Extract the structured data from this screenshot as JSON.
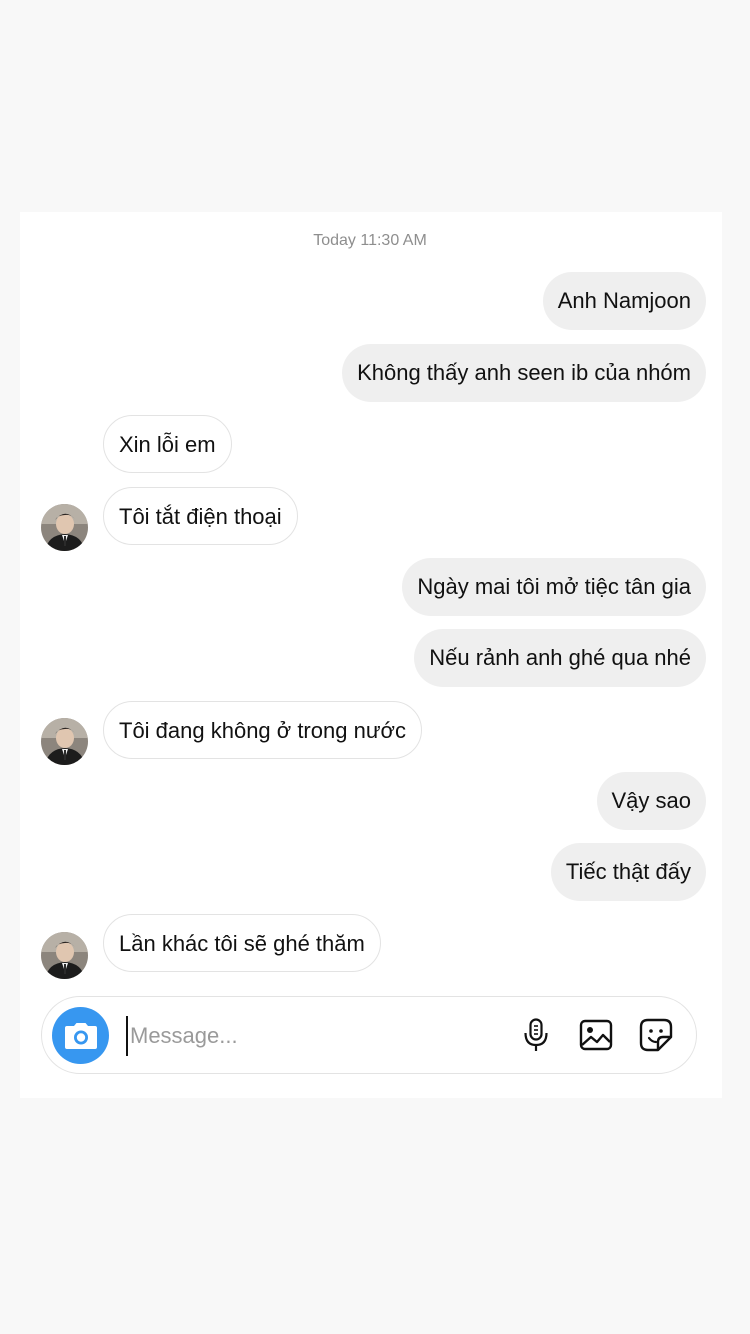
{
  "chat": {
    "timestamp": "Today 11:30 AM",
    "messages": [
      {
        "side": "sent",
        "text": "Anh Namjoon"
      },
      {
        "side": "sent",
        "text": "Không thấy anh seen ib của nhóm"
      },
      {
        "side": "received",
        "text": "Xin lỗi em"
      },
      {
        "side": "received",
        "text": "Tôi tắt điện thoại",
        "avatar": true
      },
      {
        "side": "sent",
        "text": "Ngày mai tôi mở tiệc tân gia"
      },
      {
        "side": "sent",
        "text": "Nếu rảnh anh ghé qua nhé"
      },
      {
        "side": "received",
        "text": "Tôi đang không ở trong nước",
        "avatar": true
      },
      {
        "side": "sent",
        "text": "Vậy sao"
      },
      {
        "side": "sent",
        "text": "Tiếc thật đấy"
      },
      {
        "side": "received",
        "text": "Lần khác tôi sẽ ghé thăm",
        "avatar": true
      }
    ]
  },
  "composer": {
    "placeholder": "Message...",
    "value": "",
    "camera_icon": "camera-icon",
    "mic_icon": "microphone-icon",
    "gallery_icon": "image-gallery-icon",
    "sticker_icon": "sticker-icon",
    "accent_color": "#3797f0"
  },
  "colors": {
    "sent_bubble": "#efefef",
    "received_border": "#e3e3e3",
    "timestamp": "#8e8e8e"
  }
}
